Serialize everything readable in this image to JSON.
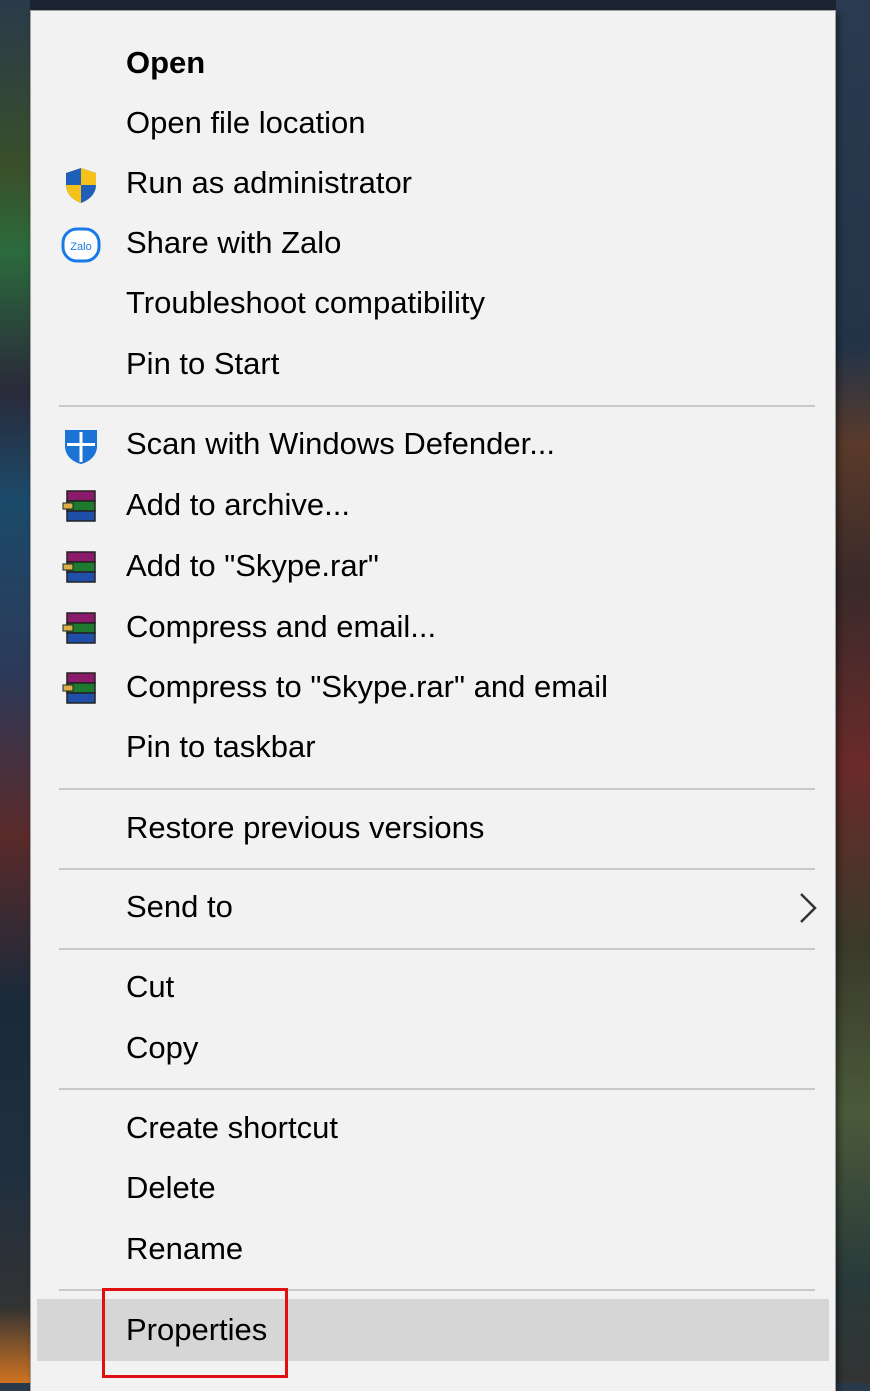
{
  "menu": {
    "items": [
      {
        "label": "Open"
      },
      {
        "label": "Open file location"
      },
      {
        "label": "Run as administrator",
        "icon": "uac-shield-icon"
      },
      {
        "label": "Share with Zalo",
        "icon": "zalo-icon",
        "icon_text": "Zalo"
      },
      {
        "label": "Troubleshoot compatibility"
      },
      {
        "label": "Pin to Start"
      },
      {
        "label": "Scan with Windows Defender...",
        "icon": "windows-defender-icon"
      },
      {
        "label": "Add to archive...",
        "icon": "winrar-icon"
      },
      {
        "label": "Add to \"Skype.rar\"",
        "icon": "winrar-icon"
      },
      {
        "label": "Compress and email...",
        "icon": "winrar-icon"
      },
      {
        "label": "Compress to \"Skype.rar\" and email",
        "icon": "winrar-icon"
      },
      {
        "label": "Pin to taskbar"
      },
      {
        "label": "Restore previous versions"
      },
      {
        "label": "Send to",
        "icon": "chevron-right-icon"
      },
      {
        "label": "Cut"
      },
      {
        "label": "Copy"
      },
      {
        "label": "Create shortcut"
      },
      {
        "label": "Delete"
      },
      {
        "label": "Rename"
      },
      {
        "label": "Properties",
        "highlighted": true
      }
    ]
  },
  "colors": {
    "menu_bg": "#f2f2f2",
    "hover_bg": "#d6d6d6",
    "separator": "#c8c8c8",
    "highlight_box": "#e01010"
  }
}
